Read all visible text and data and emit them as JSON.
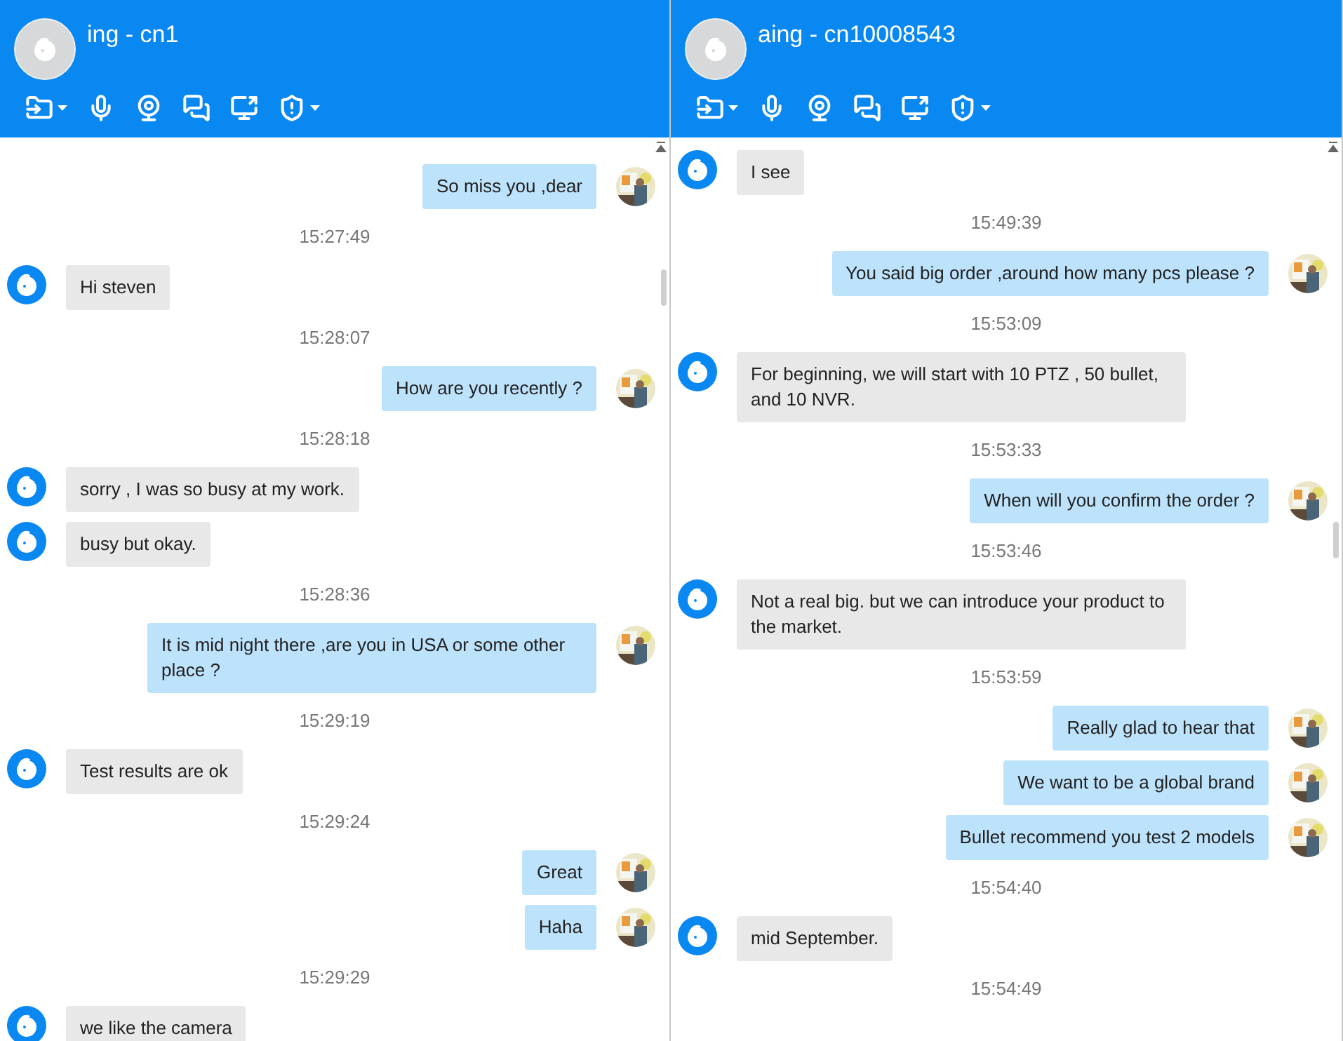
{
  "panels": [
    {
      "title": "ing - cn1",
      "messages": [
        {
          "kind": "out",
          "text": "So miss you ,dear"
        },
        {
          "kind": "time",
          "text": "15:27:49"
        },
        {
          "kind": "in",
          "text": "Hi steven"
        },
        {
          "kind": "time",
          "text": "15:28:07"
        },
        {
          "kind": "out",
          "text": "How are you recently ?"
        },
        {
          "kind": "time",
          "text": "15:28:18"
        },
        {
          "kind": "in",
          "text": "sorry , I was so busy at my work."
        },
        {
          "kind": "in",
          "text": "busy but okay."
        },
        {
          "kind": "time",
          "text": "15:28:36"
        },
        {
          "kind": "out",
          "text": "It is mid night there ,are you in USA or some other place ?"
        },
        {
          "kind": "time",
          "text": "15:29:19"
        },
        {
          "kind": "in",
          "text": "Test results are ok"
        },
        {
          "kind": "time",
          "text": "15:29:24"
        },
        {
          "kind": "out",
          "text": "Great"
        },
        {
          "kind": "out",
          "text": "Haha"
        },
        {
          "kind": "time",
          "text": "15:29:29"
        },
        {
          "kind": "in",
          "text": "we like the camera"
        }
      ]
    },
    {
      "title": "aing - cn10008543",
      "messages": [
        {
          "kind": "in",
          "text": "I see"
        },
        {
          "kind": "time",
          "text": "15:49:39"
        },
        {
          "kind": "out",
          "text": "You said big order ,around how many pcs please ?"
        },
        {
          "kind": "time",
          "text": "15:53:09"
        },
        {
          "kind": "in",
          "text": "For beginning, we will start with 10 PTZ , 50 bullet, and 10 NVR."
        },
        {
          "kind": "time",
          "text": "15:53:33"
        },
        {
          "kind": "out",
          "text": "When will you confirm the order ?"
        },
        {
          "kind": "time",
          "text": "15:53:46"
        },
        {
          "kind": "in",
          "text": "Not a real big. but we can introduce your product to the market."
        },
        {
          "kind": "time",
          "text": "15:53:59"
        },
        {
          "kind": "out",
          "text": "Really glad to hear that"
        },
        {
          "kind": "out",
          "text": "We want to be a global brand"
        },
        {
          "kind": "out",
          "text": "Bullet recommend you test 2 models"
        },
        {
          "kind": "time",
          "text": "15:54:40"
        },
        {
          "kind": "in",
          "text": "mid September."
        },
        {
          "kind": "time",
          "text": "15:54:49"
        }
      ]
    }
  ]
}
